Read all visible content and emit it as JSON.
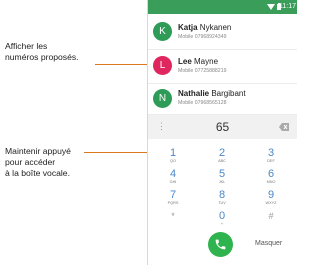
{
  "annotations": {
    "suggested_numbers": [
      "Afficher les",
      "numéros proposés."
    ],
    "voicemail": [
      "Maintenir appuyé",
      "pour accéder",
      "à la boîte vocale."
    ]
  },
  "status_bar": {
    "time": "11:17"
  },
  "contacts": [
    {
      "initial": "K",
      "name_bold": "Katja",
      "name_rest": " Nykanen",
      "number": "Mobile 07968924349",
      "color": "#2e9b57"
    },
    {
      "initial": "L",
      "name_bold": "Lee",
      "name_rest": " Mayne",
      "number": "Mobile 07725888219",
      "color": "#e0265f"
    },
    {
      "initial": "N",
      "name_bold": "Nathalie",
      "name_rest": " Bargibant",
      "number": "Mobile 07968565128",
      "color": "#2e9b57"
    }
  ],
  "dial": {
    "entered": "65",
    "menu_icon": "more-vert-icon",
    "backspace_icon": "backspace-icon"
  },
  "keypad": [
    {
      "digit": "1",
      "letters": "QO"
    },
    {
      "digit": "2",
      "letters": "ABC"
    },
    {
      "digit": "3",
      "letters": "DEF"
    },
    {
      "digit": "4",
      "letters": "GHI"
    },
    {
      "digit": "5",
      "letters": "JKL"
    },
    {
      "digit": "6",
      "letters": "MNO"
    },
    {
      "digit": "7",
      "letters": "PQRS"
    },
    {
      "digit": "8",
      "letters": "TUV"
    },
    {
      "digit": "9",
      "letters": "WXYZ"
    },
    {
      "digit": "*",
      "letters": ""
    },
    {
      "digit": "0",
      "letters": "+"
    },
    {
      "digit": "#",
      "letters": ""
    }
  ],
  "actions": {
    "call_icon": "phone-icon",
    "hide_label": "Masquer"
  },
  "colors": {
    "accent": "#d9781f",
    "status_bar": "#3a9d5a",
    "call": "#2fb34f",
    "keypad_digits": "#4a87c8"
  }
}
